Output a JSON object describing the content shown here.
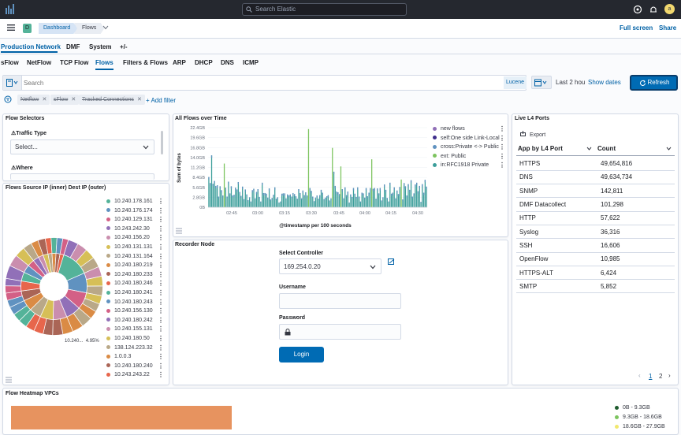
{
  "topbar": {
    "search_placeholder": "Search Elastic",
    "avatar_letter": "a"
  },
  "breadcrumbs": {
    "space_letter": "D",
    "items": [
      "Dashboard",
      "Flows"
    ]
  },
  "top_links": {
    "full_screen": "Full screen",
    "share": "Share"
  },
  "nav_primary": [
    "Production Network",
    "DMF",
    "System",
    "+/-"
  ],
  "nav_secondary": [
    "sFlow",
    "NetFlow",
    "TCP Flow",
    "Flows",
    "Filters & Flows",
    "ARP",
    "DHCP",
    "DNS",
    "ICMP"
  ],
  "query": {
    "placeholder": "Search",
    "language": "Lucene",
    "time_label": "Last 2 hou",
    "show_dates": "Show dates",
    "refresh": "Refresh"
  },
  "filters": {
    "pills": [
      "Netflow",
      "sFlow",
      "Tracked Connections"
    ],
    "add_filter": "+ Add filter"
  },
  "flow_selectors": {
    "title": "Flow Selectors",
    "traffic_type_label": "Traffic Type",
    "traffic_type_value": "Select...",
    "where_label": "Where"
  },
  "sunburst": {
    "title": "Flows Source IP (inner) Dest IP (outer)",
    "callout_label": "10.240...",
    "callout_value": "4.95%",
    "legend": [
      {
        "label": "10.240.178.161",
        "color": "#54b399"
      },
      {
        "label": "10.240.176.174",
        "color": "#6092c0"
      },
      {
        "label": "10.240.129.131",
        "color": "#d36086"
      },
      {
        "label": "10.243.242.30",
        "color": "#9170b8"
      },
      {
        "label": "10.240.156.20",
        "color": "#ca8eae"
      },
      {
        "label": "10.240.131.131",
        "color": "#d6bf57"
      },
      {
        "label": "10.240.131.164",
        "color": "#b9a888"
      },
      {
        "label": "10.240.180.219",
        "color": "#da8b45"
      },
      {
        "label": "10.240.180.233",
        "color": "#aa6556"
      },
      {
        "label": "10.240.180.246",
        "color": "#e7664c"
      },
      {
        "label": "10.240.180.241",
        "color": "#54b399"
      },
      {
        "label": "10.240.180.243",
        "color": "#6092c0"
      },
      {
        "label": "10.240.156.130",
        "color": "#d36086"
      },
      {
        "label": "10.240.180.242",
        "color": "#9170b8"
      },
      {
        "label": "10.240.155.131",
        "color": "#ca8eae"
      },
      {
        "label": "10.240.180.50",
        "color": "#d6bf57"
      },
      {
        "label": "138.124.223.32",
        "color": "#b9a888"
      },
      {
        "label": "1.0.0.3",
        "color": "#da8b45"
      },
      {
        "label": "10.240.180.240",
        "color": "#aa6556"
      },
      {
        "label": "10.243.243.22",
        "color": "#e7664c"
      }
    ]
  },
  "flows_chart": {
    "title": "All Flows over Time",
    "legend": [
      {
        "label": "new flows",
        "color": "#9170b8"
      },
      {
        "label": "self:One side Link-Local",
        "color": "#3f2e8c"
      },
      {
        "label": "cross:Private <-> Public",
        "color": "#6092c0"
      },
      {
        "label": "ext: Public",
        "color": "#7dc45f"
      },
      {
        "label": "in:RFC1918 Private",
        "color": "#3c9e9a"
      }
    ]
  },
  "chart_data": {
    "type": "bar",
    "title": "All Flows over Time",
    "xlabel": "@timestamp per 100 seconds",
    "ylabel": "Sum of bytes",
    "y_ticks": [
      "0B",
      "2.8GB",
      "5.6GB",
      "8.4GB",
      "11.2GB",
      "14.0GB",
      "16.8GB",
      "19.6GB",
      "22.4GB"
    ],
    "x_ticks": [
      "02:45",
      "03:00",
      "03:15",
      "03:30",
      "03:45",
      "04:00",
      "04:15",
      "04:30"
    ],
    "ylim": [
      0,
      22.4
    ],
    "values": [
      8.5,
      6.8,
      14.6,
      6.6,
      7.4,
      6.0,
      6.2,
      3.0,
      5.9,
      4.8,
      3.3,
      12.3,
      5.5,
      3.0,
      7.2,
      3.9,
      5.9,
      3.3,
      3.5,
      5.5,
      5.0,
      7.1,
      4.3,
      3.2,
      5.8,
      2.3,
      5.0,
      3.6,
      2.0,
      2.8,
      1.6,
      4.8,
      5.2,
      2.5,
      4.3,
      5.1,
      2.9,
      1.6,
      6.9,
      4.0,
      4.0,
      3.8,
      2.7,
      5.3,
      2.2,
      2.6,
      3.5,
      5.6,
      2.4,
      2.8,
      1.3,
      1.6,
      3.8,
      3.9,
      3.9,
      2.5,
      3.6,
      3.3,
      3.6,
      3.0,
      4.0,
      3.7,
      3.1,
      2.4,
      5.1,
      4.0,
      2.5,
      4.7,
      3.4,
      4.2,
      3.3,
      22.0,
      5.4,
      4.6,
      3.0,
      1.7,
      2.7,
      3.3,
      2.4,
      3.4,
      4.9,
      4.1,
      2.3,
      2.7,
      3.1,
      3.4,
      1.9,
      2.5,
      16.7,
      10.0,
      6.0,
      4.4,
      4.2,
      3.7,
      11.5,
      5.1,
      2.5,
      5.6,
      3.4,
      4.4,
      1.3,
      3.6,
      2.9,
      5.4,
      3.8,
      2.9,
      5.6,
      3.0,
      1.6,
      4.1,
      3.9,
      2.7,
      5.4,
      3.1,
      4.1,
      5.4,
      13.5,
      5.2,
      5.4,
      2.4,
      5.3,
      3.9,
      5.4,
      1.9,
      2.8,
      6.4,
      4.9,
      2.6,
      1.6,
      6.9,
      3.8,
      4.1,
      5.6,
      2.5,
      4.7,
      3.7,
      5.7,
      7.8,
      2.2,
      6.8,
      5.9,
      3.3,
      6.5,
      4.9,
      7.6,
      3.0,
      3.9,
      6.4,
      6.9,
      4.5,
      6.0,
      1.5,
      6.5,
      4.1,
      7.7,
      5.8
    ]
  },
  "recorder": {
    "title": "Recorder Node",
    "controller_label": "Select Controller",
    "controller_value": "169.254.0.20",
    "username_label": "Username",
    "password_label": "Password",
    "login": "Login"
  },
  "l4ports": {
    "title": "Live L4 Ports",
    "export": "Export",
    "col_app": "App by L4 Port",
    "col_count": "Count",
    "rows": [
      {
        "app": "HTTPS",
        "count": "49,654,816"
      },
      {
        "app": "DNS",
        "count": "49,634,734"
      },
      {
        "app": "SNMP",
        "count": "142,811"
      },
      {
        "app": "DMF Datacollect",
        "count": "101,298"
      },
      {
        "app": "HTTP",
        "count": "57,622"
      },
      {
        "app": "Syslog",
        "count": "36,316"
      },
      {
        "app": "SSH",
        "count": "16,606"
      },
      {
        "app": "OpenFlow",
        "count": "10,985"
      },
      {
        "app": "HTTPS-ALT",
        "count": "6,424"
      },
      {
        "app": "SMTP",
        "count": "5,852"
      }
    ],
    "pages": [
      "1",
      "2"
    ]
  },
  "heatmap": {
    "title": "Flow Heatmap VPCs",
    "legend": [
      {
        "label": "0B - 9.3GB",
        "color": "#1e5b2e"
      },
      {
        "label": "9.3GB - 18.6GB",
        "color": "#7dc45f"
      },
      {
        "label": "18.6GB - 27.9GB",
        "color": "#f1e86e"
      }
    ]
  }
}
